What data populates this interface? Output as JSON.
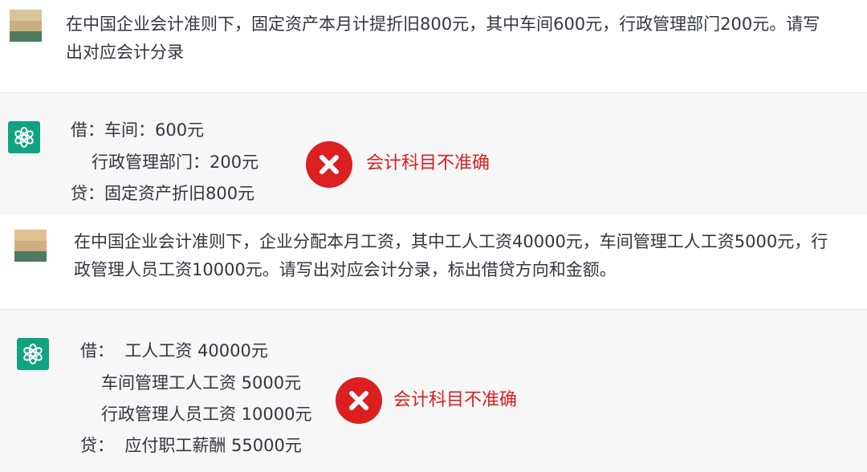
{
  "messages": [
    {
      "role": "user",
      "lines": [
        "在中国企业会计准则下，固定资产本月计提折旧800元，其中车间600元，行政管理部门200元。请写",
        "出对应会计分录"
      ]
    },
    {
      "role": "assistant",
      "lines": [
        "借：车间：600元",
        "行政管理部门：200元",
        "贷：固定资产折旧800元"
      ],
      "annotation": "会计科目不准确"
    },
    {
      "role": "user",
      "lines": [
        "在中国企业会计准则下，企业分配本月工资，其中工人工资40000元，车间管理工人工资5000元，行",
        "政管理人员工资10000元。请写出对应会计分录，标出借贷方向和金额。"
      ]
    },
    {
      "role": "assistant",
      "lines": [
        "借：  工人工资 40000元",
        "车间管理工人工资 5000元",
        "行政管理人员工资 10000元",
        "贷：  应付职工薪酬 55000元"
      ],
      "annotation": "会计科目不准确"
    }
  ],
  "colors": {
    "assistant_avatar": "#10a37f",
    "error_mark": "#dc1f1f",
    "assistant_bg": "#f7f7f8"
  },
  "icons": {
    "assistant_avatar": "openai-logo-icon",
    "user_avatar": "blurred-user-avatar",
    "error_mark": "red-x-circle-icon"
  }
}
